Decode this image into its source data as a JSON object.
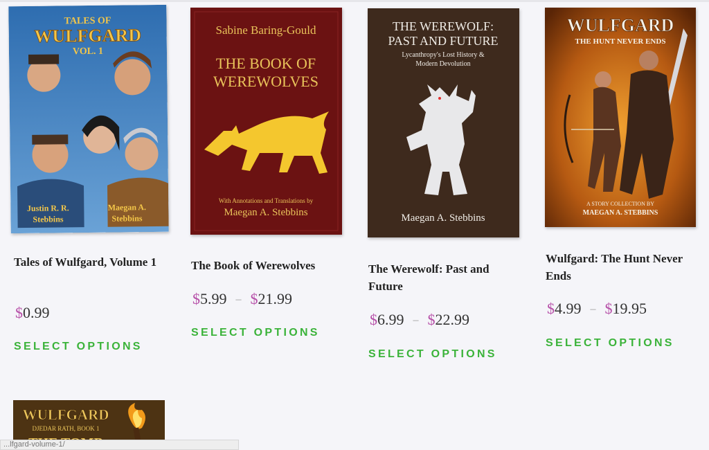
{
  "products": [
    {
      "title": "Tales of Wulfgard, Volume 1",
      "price": {
        "currency": "$",
        "low": "0.99"
      },
      "cta": "SELECT OPTIONS",
      "cover": {
        "series": "TALES OF",
        "brand": "WULFGARD",
        "volume": "VOL. 1",
        "author_left": "Justin R. R. Stebbins",
        "author_right": "Maegan A. Stebbins",
        "color": "#3f7fb8"
      }
    },
    {
      "title": "The Book of Werewolves",
      "price": {
        "currency": "$",
        "low": "5.99",
        "high": "21.99",
        "sep": "–"
      },
      "cta": "SELECT OPTIONS",
      "cover": {
        "top_author": "Sabine Baring-Gould",
        "line1": "THE BOOK OF",
        "line2": "WEREWOLVES",
        "credit": "With Annotations and Translations by",
        "author": "Maegan A. Stebbins",
        "color": "#6b1212"
      }
    },
    {
      "title": "The Werewolf: Past and Future",
      "price": {
        "currency": "$",
        "low": "6.99",
        "high": "22.99",
        "sep": "–"
      },
      "cta": "SELECT OPTIONS",
      "cover": {
        "line1": "THE WEREWOLF:",
        "line2": "PAST AND FUTURE",
        "sub1": "Lycanthropy's Lost History &",
        "sub2": "Modern Devolution",
        "author": "Maegan A. Stebbins",
        "color": "#3e2a1d"
      }
    },
    {
      "title": "Wulfgard: The Hunt Never Ends",
      "price": {
        "currency": "$",
        "low": "4.99",
        "high": "19.95",
        "sep": "–"
      },
      "cta": "SELECT OPTIONS",
      "cover": {
        "brand": "WULFGARD",
        "tagline": "THE HUNT NEVER ENDS",
        "credit": "A STORY COLLECTION BY",
        "author": "MAEGAN A. STEBBINS",
        "color": "#b65a12"
      }
    },
    {
      "cover": {
        "brand": "WULFGARD",
        "sub": "DJEDAR RATH, BOOK 1",
        "line1": "THE TOMB",
        "color": "#5a3a14"
      }
    }
  ],
  "status_bar": {
    "url": "...lfgard-volume-1/"
  }
}
